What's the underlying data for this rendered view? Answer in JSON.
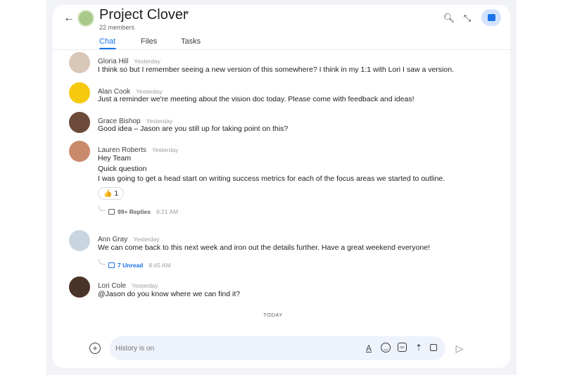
{
  "header": {
    "title": "Project Clover",
    "members": "22 members"
  },
  "tabs": [
    {
      "label": "Chat",
      "active": true
    },
    {
      "label": "Files"
    },
    {
      "label": "Tasks"
    }
  ],
  "messages": [
    {
      "name": "Gloria Hill",
      "time": "Yesterday",
      "lines": [
        "I think so but I remember seeing a new version of this somewhere? I think in my 1:1 with Lori I saw a version."
      ],
      "avatar_color": "#d9c7b8"
    },
    {
      "name": "Alan Cook",
      "time": "Yesterday",
      "lines": [
        "Just a reminder we're meeting about the vision doc today. Please come with feedback and ideas!"
      ],
      "avatar_color": "#f6c90e"
    },
    {
      "name": "Grace Bishop",
      "time": "Yesterday",
      "lines": [
        "Good idea – Jason are you still up for taking point on this?"
      ],
      "avatar_color": "#6b4a3a"
    },
    {
      "name": "Lauren Roberts",
      "time": "Yesterday",
      "lines": [
        "Hey Team",
        "Quick question",
        "I was going to get a head start on writing success metrics for each of the focus areas we started to outline."
      ],
      "avatar_color": "#c98a6b",
      "reaction": {
        "emoji": "👍",
        "count": "1"
      },
      "thread": {
        "label": "99+ Replies",
        "time": "9:21 AM"
      }
    },
    {
      "name": "Ann Gray",
      "time": "Yesterday",
      "lines": [
        "We can come back to this next week and iron out the details further. Have a great weekend everyone!"
      ],
      "avatar_color": "#c9d6df",
      "thread": {
        "label": "7 Unread",
        "time": "8:45 AM"
      }
    },
    {
      "name": "Lori Cole",
      "time": "Yesterday",
      "lines": [
        "@Jason do you know where we can find it?"
      ],
      "avatar_color": "#4a3328"
    }
  ],
  "divider": "TODAY",
  "composer": {
    "placeholder": "History is on"
  },
  "colors": {
    "accent": "#1a73e8",
    "input_bg": "#eef2fb"
  }
}
